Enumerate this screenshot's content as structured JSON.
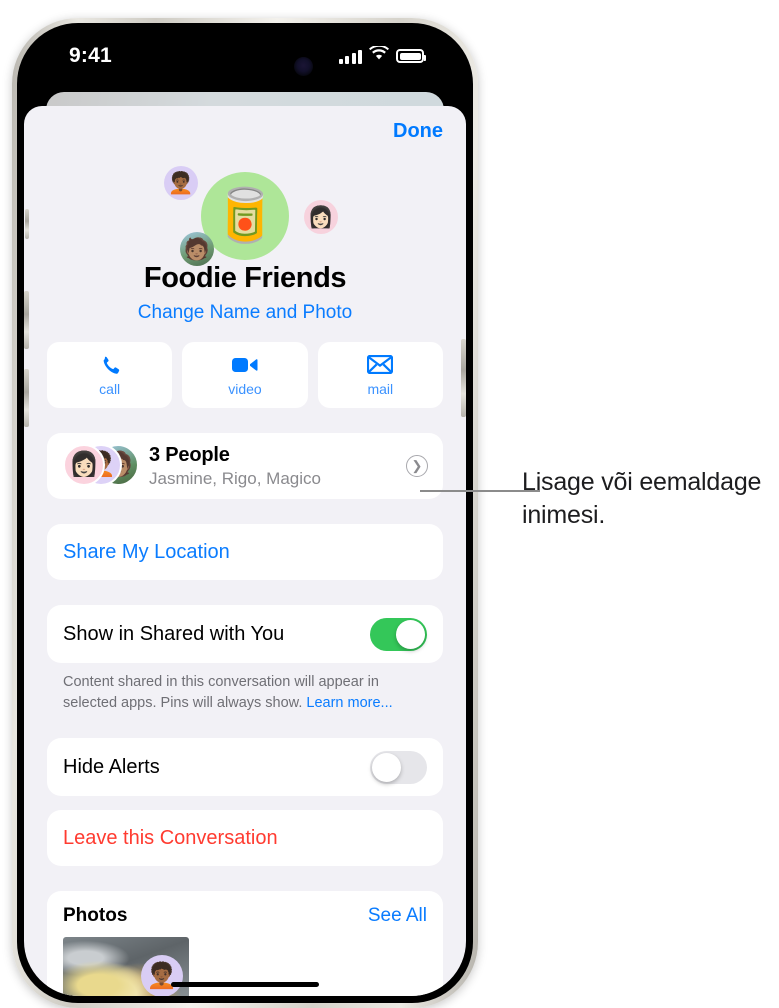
{
  "status_bar": {
    "time": "9:41",
    "signal_icon": "cellular-signal-icon",
    "wifi_icon": "wifi-icon",
    "battery_icon": "battery-icon"
  },
  "sheet": {
    "done_label": "Done"
  },
  "group": {
    "avatar_emoji": "🥫",
    "avatar_bg": "#aee698",
    "member_emojis": [
      "🧑🏾‍🦱",
      "👩🏻",
      "🧑🏽"
    ],
    "name": "Foodie Friends",
    "change_link": "Change Name and Photo"
  },
  "actions": [
    {
      "label": "call",
      "icon": "phone-icon"
    },
    {
      "label": "video",
      "icon": "video-camera-icon"
    },
    {
      "label": "mail",
      "icon": "envelope-icon"
    }
  ],
  "people": {
    "title": "3 People",
    "subtitle": "Jasmine, Rigo, Magico",
    "chevron_icon": "chevron-right-icon",
    "avatars": [
      "👩🏻",
      "🧑🏾‍🦱",
      "🧑🏽"
    ]
  },
  "share_location": {
    "label": "Share My Location"
  },
  "shared_with_you": {
    "label": "Show in Shared with You",
    "enabled": true,
    "helper_text": "Content shared in this conversation will appear in selected apps. Pins will always show. ",
    "helper_link": "Learn more..."
  },
  "hide_alerts": {
    "label": "Hide Alerts",
    "enabled": false
  },
  "leave": {
    "label": "Leave this Conversation"
  },
  "photos": {
    "title": "Photos",
    "see_all": "See All",
    "thumb_overlay_emoji": "🧑🏾‍🦱"
  },
  "callout": {
    "text": "Lisage või eemaldage inimesi."
  },
  "colors": {
    "accent_blue": "#0a7cff",
    "destructive_red": "#ff3b30",
    "toggle_green": "#34c759",
    "sheet_bg": "#f2f1f6"
  }
}
